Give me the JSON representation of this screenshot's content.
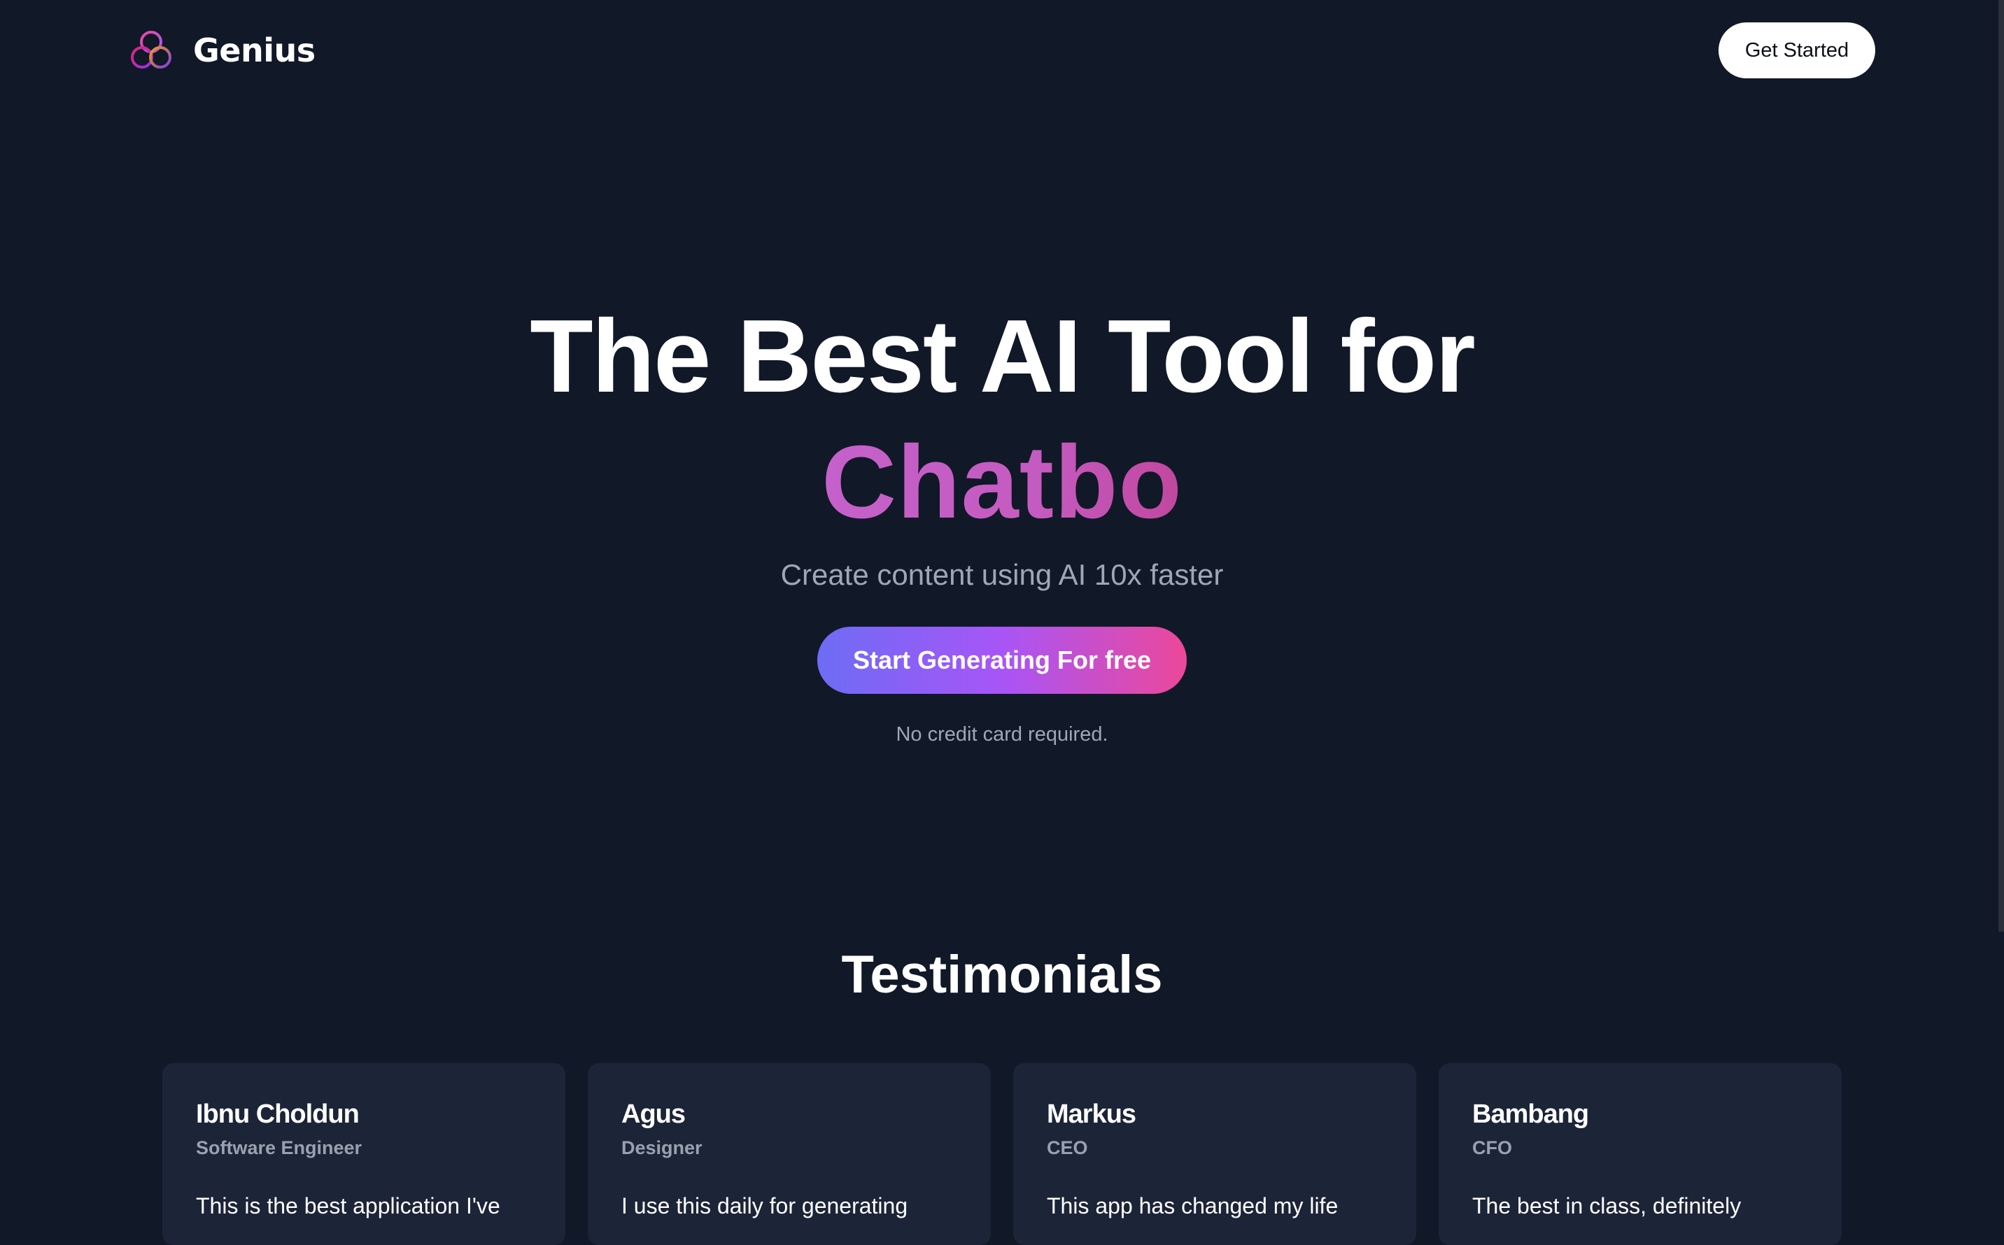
{
  "brand": {
    "name": "Genius",
    "logo_icon": "genius-trefoil-logo"
  },
  "navbar": {
    "get_started_label": "Get Started"
  },
  "hero": {
    "title": "The Best AI Tool for",
    "typed_text": "Chatbo",
    "subtitle": "Create content using AI 10x faster",
    "cta_label": "Start Generating For free",
    "cta_note": "No credit card required."
  },
  "testimonials": {
    "heading": "Testimonials",
    "cards": [
      {
        "name": "Ibnu Choldun",
        "role": "Software Engineer",
        "quote": "This is the best application I've"
      },
      {
        "name": "Agus",
        "role": "Designer",
        "quote": "I use this daily for generating"
      },
      {
        "name": "Markus",
        "role": "CEO",
        "quote": "This app has changed my life"
      },
      {
        "name": "Bambang",
        "role": "CFO",
        "quote": "The best in class, definitely"
      }
    ]
  },
  "colors": {
    "background": "#111827",
    "card_background": "#1c2438",
    "typed_text": "#c45bc0",
    "cta_gradient_start": "#6d6cf5",
    "cta_gradient_end": "#ec4899",
    "muted_text": "#a0a7b4"
  }
}
